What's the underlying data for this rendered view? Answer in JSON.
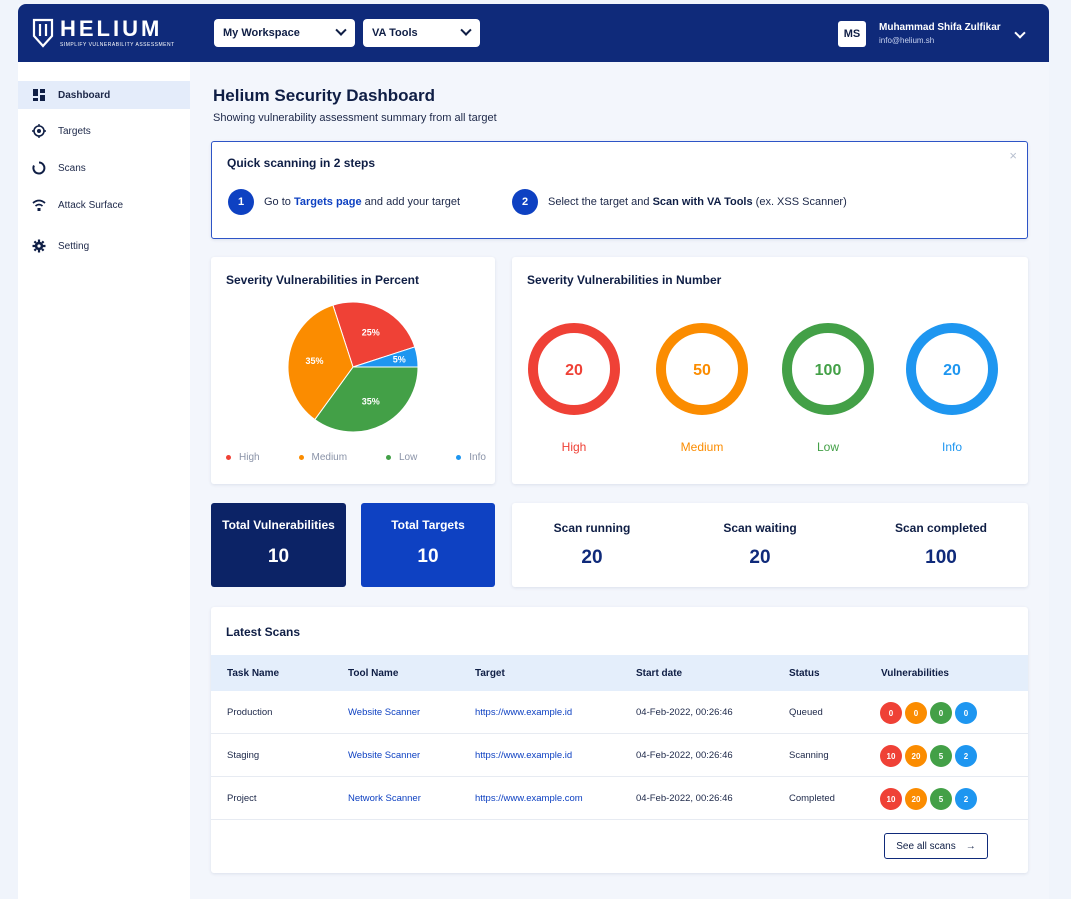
{
  "brand": {
    "name": "HELIUM",
    "tagline": "SIMPLIFY VULNERABILITY ASSESSMENT"
  },
  "header": {
    "workspace": "My Workspace",
    "tools": "VA Tools",
    "avatar": "MS",
    "user_name": "Muhammad Shifa Zulfikar",
    "user_email": "info@helium.sh"
  },
  "sidebar": {
    "items": [
      {
        "label": "Dashboard",
        "icon": "dashboard-icon"
      },
      {
        "label": "Targets",
        "icon": "target-icon"
      },
      {
        "label": "Scans",
        "icon": "scan-icon"
      },
      {
        "label": "Attack Surface",
        "icon": "wifi-icon"
      },
      {
        "label": "Setting",
        "icon": "gear-icon"
      }
    ]
  },
  "page": {
    "title": "Helium Security Dashboard",
    "subtitle": "Showing vulnerability assessment summary from all target"
  },
  "quick": {
    "title": "Quick scanning in 2 steps",
    "close": "×",
    "step1_num": "1",
    "step1_pre": "Go to ",
    "step1_link": "Targets page",
    "step1_post": " and add your target",
    "step2_num": "2",
    "step2_pre": "Select the target and ",
    "step2_bold": "Scan with VA Tools",
    "step2_post": " (ex. XSS Scanner)"
  },
  "colors": {
    "high": "#ef4136",
    "medium": "#fb8c00",
    "low": "#43a047",
    "info": "#1e96f0",
    "navy": "#0f2a7a",
    "blue": "#0e41c2"
  },
  "chart_data": [
    {
      "type": "pie",
      "title": "Severity Vulnerabilities in Percent",
      "categories": [
        "High",
        "Medium",
        "Low",
        "Info"
      ],
      "values": [
        25,
        35,
        35,
        5
      ],
      "labels": [
        "25%",
        "35%",
        "35%",
        "5%"
      ],
      "legend": "bottom"
    },
    {
      "type": "ring",
      "title": "Severity Vulnerabilities in Number",
      "categories": [
        "High",
        "Medium",
        "Low",
        "Info"
      ],
      "values": [
        20,
        50,
        100,
        20
      ]
    }
  ],
  "stats": {
    "total_vuln_label": "Total Vulnerabilities",
    "total_vuln_value": "10",
    "total_targets_label": "Total Targets",
    "total_targets_value": "10"
  },
  "scans_summary": {
    "running_label": "Scan running",
    "running_value": "20",
    "waiting_label": "Scan waiting",
    "waiting_value": "20",
    "completed_label": "Scan completed",
    "completed_value": "100"
  },
  "latest": {
    "title": "Latest Scans",
    "columns": [
      "Task Name",
      "Tool Name",
      "Target",
      "Start date",
      "Status",
      "Vulnerabilities"
    ],
    "rows": [
      {
        "task": "Production",
        "tool": "Website Scanner",
        "target": "https://www.example.id",
        "date": "04-Feb-2022, 00:26:46",
        "status": "Queued",
        "vulns": [
          "0",
          "0",
          "0",
          "0"
        ]
      },
      {
        "task": "Staging",
        "tool": "Website Scanner",
        "target": "https://www.example.id",
        "date": "04-Feb-2022, 00:26:46",
        "status": "Scanning",
        "vulns": [
          "10",
          "20",
          "5",
          "2"
        ]
      },
      {
        "task": "Project",
        "tool": "Network Scanner",
        "target": "https://www.example.com",
        "date": "04-Feb-2022, 00:26:46",
        "status": "Completed",
        "vulns": [
          "10",
          "20",
          "5",
          "2"
        ]
      }
    ],
    "see_all": "See all scans",
    "see_all_arrow": "→"
  }
}
